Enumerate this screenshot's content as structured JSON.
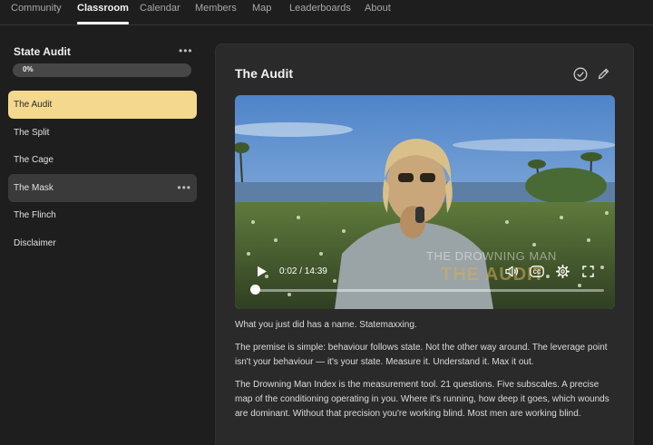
{
  "nav": {
    "tabs": [
      {
        "label": "Community"
      },
      {
        "label": "Classroom"
      },
      {
        "label": "Calendar"
      },
      {
        "label": "Members"
      },
      {
        "label": "Map"
      },
      {
        "label": "Leaderboards"
      },
      {
        "label": "About"
      }
    ],
    "active_tab": "Classroom"
  },
  "sidebar": {
    "course_title": "State Audit",
    "more": "•••",
    "progress_label": "0%",
    "progress_fraction": 0,
    "lessons": [
      {
        "label": "The Audit"
      },
      {
        "label": "The Split"
      },
      {
        "label": "The Cage"
      },
      {
        "label": "The Mask"
      },
      {
        "label": "The Flinch"
      },
      {
        "label": "Disclaimer"
      }
    ],
    "active_lesson": "The Audit",
    "hovered_lesson": "The Mask"
  },
  "content": {
    "title": "The Audit",
    "video": {
      "overlay_line1": "THE DROWNING MAN",
      "overlay_line2": "THE AUDIT",
      "time": "0:02 / 14:39",
      "played_fraction": 0.0023
    },
    "paragraphs": [
      "What you just did has a name. Statemaxxing.",
      "The premise is simple: behaviour follows state. Not the other way around. The leverage point isn't your behaviour — it's your state. Measure it. Understand it. Max it out.",
      "The Drowning Man Index is the measurement tool. 21 questions. Five subscales. A precise map of the conditioning operating in you.  Where it's running, how deep it goes, which wounds are dominant. Without that precision you're working blind. Most men are working blind."
    ]
  },
  "colors": {
    "background": "#1e1e1e",
    "card": "#2a2a2a",
    "active_lesson": "#f4d88e",
    "hover_lesson": "#3a3a3a"
  },
  "icons": [
    "check-circle-icon",
    "pencil-icon",
    "play-icon",
    "volume-icon",
    "captions-icon",
    "gear-icon",
    "fullscreen-icon"
  ]
}
